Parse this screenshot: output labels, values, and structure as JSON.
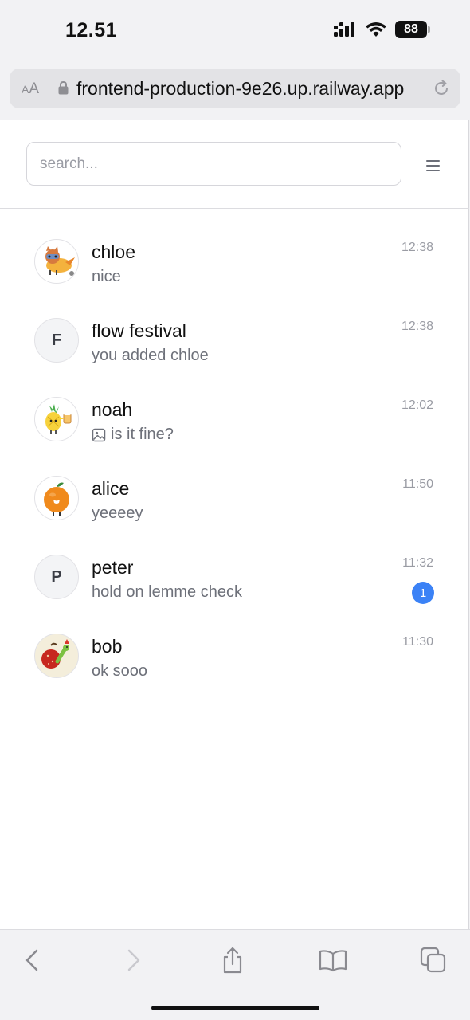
{
  "status_bar": {
    "time": "12.51",
    "battery": "88"
  },
  "browser": {
    "aa_small": "A",
    "aa_large": "A",
    "url": "frontend-production-9e26.up.railway.app"
  },
  "search": {
    "placeholder": "search..."
  },
  "chats": [
    {
      "name": "chloe",
      "preview": "nice",
      "time": "12:38",
      "avatar": "bird-fox-sticker"
    },
    {
      "name": "flow festival",
      "preview": "you added chloe",
      "time": "12:38",
      "avatar_letter": "F"
    },
    {
      "name": "noah",
      "preview": "is it fine?",
      "time": "12:02",
      "avatar": "pineapple-sticker",
      "preview_icon": "image-icon"
    },
    {
      "name": "alice",
      "preview": "yeeeey",
      "time": "11:50",
      "avatar": "orange-sticker"
    },
    {
      "name": "peter",
      "preview": "hold on lemme check",
      "time": "11:32",
      "avatar_letter": "P",
      "unread": "1"
    },
    {
      "name": "bob",
      "preview": "ok sooo",
      "time": "11:30",
      "avatar": "apple-worm-sticker"
    }
  ],
  "colors": {
    "accent": "#3b82f6",
    "muted_text": "#6e717a",
    "time_text": "#9a9ca4"
  },
  "toolbar_icons": [
    "back-icon",
    "forward-icon",
    "share-icon",
    "bookmarks-icon",
    "tabs-icon"
  ]
}
